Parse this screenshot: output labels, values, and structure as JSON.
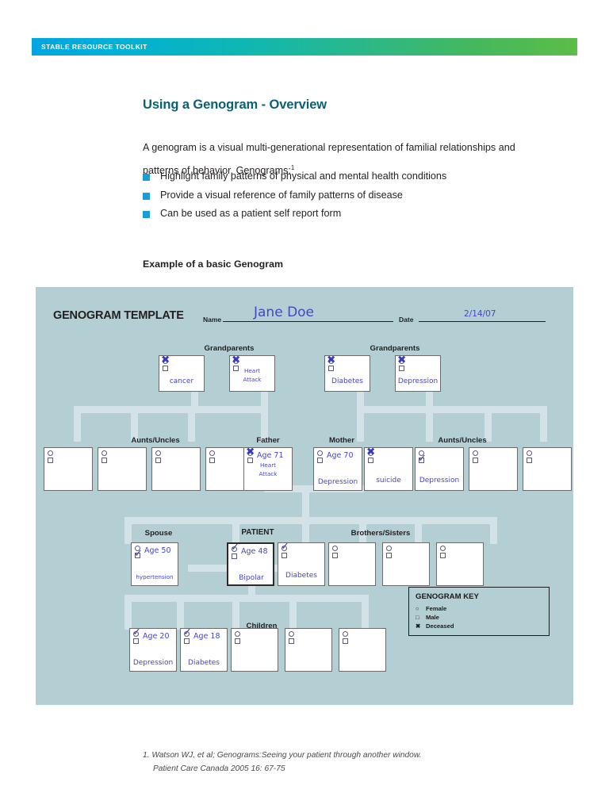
{
  "banner": {
    "text": "STABLE RESOURCE TOOLKIT"
  },
  "colors": {
    "banner_start": "#00a5e0",
    "banner_end": "#5cbd47",
    "heading": "#0d6070",
    "bullet": "#1b9bd8",
    "panel_bg": "#b3cfd4",
    "connector": "#d3e2e7",
    "handwriting": "#4545c8"
  },
  "page": {
    "title": "Using a Genogram - Overview",
    "intro": "A genogram is a visual multi-generational representation of familial relationships and patterns of behavior. Genograms:",
    "intro_footnote_marker": "1",
    "bullets": [
      "Highlight family patterns of physical and mental health conditions",
      "Provide a visual reference of family patterns of disease",
      "Can be used as a patient self report form"
    ],
    "example_label": "Example of a basic Genogram",
    "footnote_line1": "1. Watson WJ, et al; Genograms:Seeing your patient through another window.",
    "footnote_line2": "Patient Care Canada 2005 16: 67-75"
  },
  "template": {
    "title": "GENOGRAM TEMPLATE",
    "name_label": "Name",
    "name_value": "Jane Doe",
    "date_label": "Date",
    "date_value": "2/14/07"
  },
  "captions": {
    "grandparents_left": "Grandparents",
    "grandparents_right": "Grandparents",
    "aunts_uncles_left": "Aunts/Uncles",
    "father": "Father",
    "mother": "Mother",
    "aunts_uncles_right": "Aunts/Uncles",
    "spouse": "Spouse",
    "patient": "PATIENT",
    "brothers_sisters": "Brothers/Sisters",
    "children": "Children"
  },
  "key": {
    "title": "GENOGRAM KEY",
    "rows": [
      {
        "glyph": "○",
        "label": "Female"
      },
      {
        "glyph": "□",
        "label": "Male"
      },
      {
        "glyph": "✖",
        "label": "Deceased"
      }
    ]
  },
  "grandparents": [
    {
      "age": "",
      "condition": "cancer",
      "deceased": true,
      "female_checked": false,
      "male_checked": false
    },
    {
      "age": "",
      "condition": "Heart\nAttack",
      "deceased": true,
      "female_checked": false,
      "male_checked": false
    },
    {
      "age": "",
      "condition": "Diabetes",
      "deceased": true,
      "female_checked": false,
      "male_checked": false
    },
    {
      "age": "",
      "condition": "Depression",
      "deceased": true,
      "female_checked": false,
      "male_checked": false
    }
  ],
  "parents_row": [
    {
      "age": "",
      "condition": "",
      "deceased": false,
      "female_checked": false,
      "male_checked": false
    },
    {
      "age": "",
      "condition": "",
      "deceased": false,
      "female_checked": false,
      "male_checked": false
    },
    {
      "age": "",
      "condition": "",
      "deceased": false,
      "female_checked": false,
      "male_checked": false
    },
    {
      "age": "",
      "condition": "",
      "deceased": false,
      "female_checked": false,
      "male_checked": false
    },
    {
      "age": "Age 71",
      "condition": "Heart\nAttack",
      "deceased": true,
      "female_checked": false,
      "male_checked": false
    },
    {
      "age": "Age 70",
      "condition": "Depression",
      "deceased": false,
      "female_checked": false,
      "male_checked": false
    },
    {
      "age": "",
      "condition": "suicide",
      "deceased": true,
      "female_checked": false,
      "male_checked": false
    },
    {
      "age": "",
      "condition": "Depression",
      "deceased": false,
      "female_checked": false,
      "male_checked": true
    },
    {
      "age": "",
      "condition": "",
      "deceased": false,
      "female_checked": false,
      "male_checked": false
    },
    {
      "age": "",
      "condition": "",
      "deceased": false,
      "female_checked": false,
      "male_checked": false
    }
  ],
  "patient_row": [
    {
      "age": "Age 50",
      "condition": "hypertension",
      "deceased": false,
      "female_checked": false,
      "male_checked": true,
      "is_patient": false
    },
    {
      "age": "Age 48",
      "condition": "Bipolar",
      "deceased": false,
      "female_checked": true,
      "male_checked": false,
      "is_patient": true
    },
    {
      "age": "",
      "condition": "Diabetes",
      "deceased": false,
      "female_checked": true,
      "male_checked": false,
      "is_patient": false
    },
    {
      "age": "",
      "condition": "",
      "deceased": false,
      "female_checked": false,
      "male_checked": false,
      "is_patient": false
    },
    {
      "age": "",
      "condition": "",
      "deceased": false,
      "female_checked": false,
      "male_checked": false,
      "is_patient": false
    },
    {
      "age": "",
      "condition": "",
      "deceased": false,
      "female_checked": false,
      "male_checked": false,
      "is_patient": false
    }
  ],
  "children_row": [
    {
      "age": "Age 20",
      "condition": "Depression",
      "deceased": false,
      "female_checked": true,
      "male_checked": false
    },
    {
      "age": "Age 18",
      "condition": "Diabetes",
      "deceased": false,
      "female_checked": true,
      "male_checked": false
    },
    {
      "age": "",
      "condition": "",
      "deceased": false,
      "female_checked": false,
      "male_checked": false
    },
    {
      "age": "",
      "condition": "",
      "deceased": false,
      "female_checked": false,
      "male_checked": false
    },
    {
      "age": "",
      "condition": "",
      "deceased": false,
      "female_checked": false,
      "male_checked": false
    }
  ]
}
